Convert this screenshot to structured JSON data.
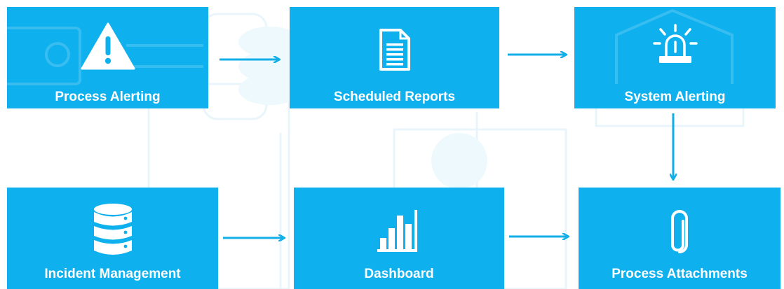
{
  "diagram": {
    "nodes": {
      "process_alerting": {
        "label": "Process Alerting",
        "icon": "warning-triangle-icon"
      },
      "scheduled_reports": {
        "label": "Scheduled Reports",
        "icon": "document-icon"
      },
      "system_alerting": {
        "label": "System Alerting",
        "icon": "siren-light-icon"
      },
      "incident_management": {
        "label": "Incident Management",
        "icon": "database-icon"
      },
      "dashboard": {
        "label": "Dashboard",
        "icon": "bar-chart-icon"
      },
      "process_attachments": {
        "label": "Process Attachments",
        "icon": "paperclip-icon"
      }
    },
    "edges": [
      {
        "from": "Process Alerting",
        "to": "Scheduled Reports"
      },
      {
        "from": "Scheduled Reports",
        "to": "System Alerting"
      },
      {
        "from": "System Alerting",
        "to": "Process Attachments"
      },
      {
        "from": "Incident Management",
        "to": "Dashboard"
      },
      {
        "from": "Dashboard",
        "to": "Process Attachments"
      }
    ]
  },
  "colors": {
    "node_fill": "#0fb0ee",
    "arrow": "#12aee8",
    "text": "#ffffff",
    "background_ghost": "#e6f6fd"
  }
}
